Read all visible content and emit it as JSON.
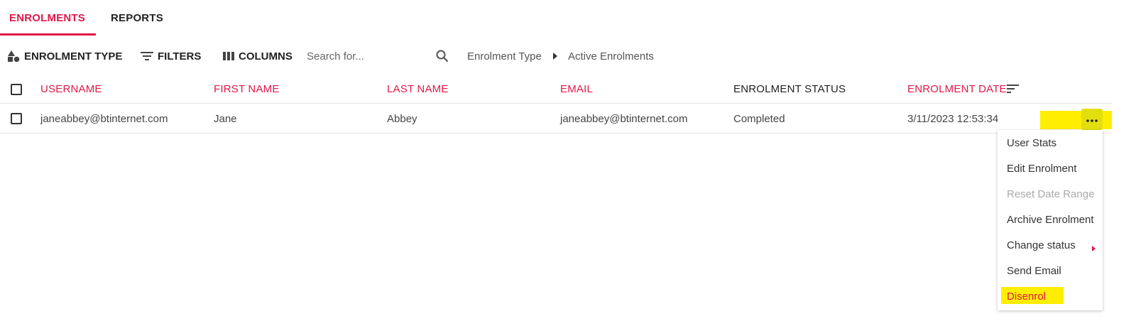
{
  "tabs": [
    {
      "label": "ENROLMENTS",
      "active": true
    },
    {
      "label": "REPORTS",
      "active": false
    }
  ],
  "toolbar": {
    "enrolment_type_label": "ENROLMENT TYPE",
    "filters_label": "FILTERS",
    "columns_label": "COLUMNS",
    "search_placeholder": "Search for...",
    "breadcrumb": [
      "Enrolment Type",
      "Active Enrolments"
    ]
  },
  "table": {
    "columns": [
      "USERNAME",
      "FIRST NAME",
      "LAST NAME",
      "EMAIL",
      "ENROLMENT STATUS",
      "ENROLMENT DATE"
    ],
    "rows": [
      {
        "username": "janeabbey@btinternet.com",
        "first_name": "Jane",
        "last_name": "Abbey",
        "email": "janeabbey@btinternet.com",
        "status": "Completed",
        "date": "3/11/2023 12:53:34"
      }
    ]
  },
  "row_menu": {
    "items": [
      "User Stats",
      "Edit Enrolment",
      "Reset Date Range",
      "Archive Enrolment",
      "Change status",
      "Send Email",
      "Disenrol"
    ],
    "disabled": [
      "Reset Date Range"
    ]
  },
  "colors": {
    "accent": "#e0184a",
    "highlight": "#ffee00",
    "text": "#333333",
    "disabled": "#aaaaaa"
  },
  "icons": [
    "shapes-icon",
    "filter-icon",
    "columns-icon",
    "search-icon",
    "caret-right-icon",
    "sort-icon",
    "more-dots-icon",
    "submenu-arrow-icon"
  ]
}
